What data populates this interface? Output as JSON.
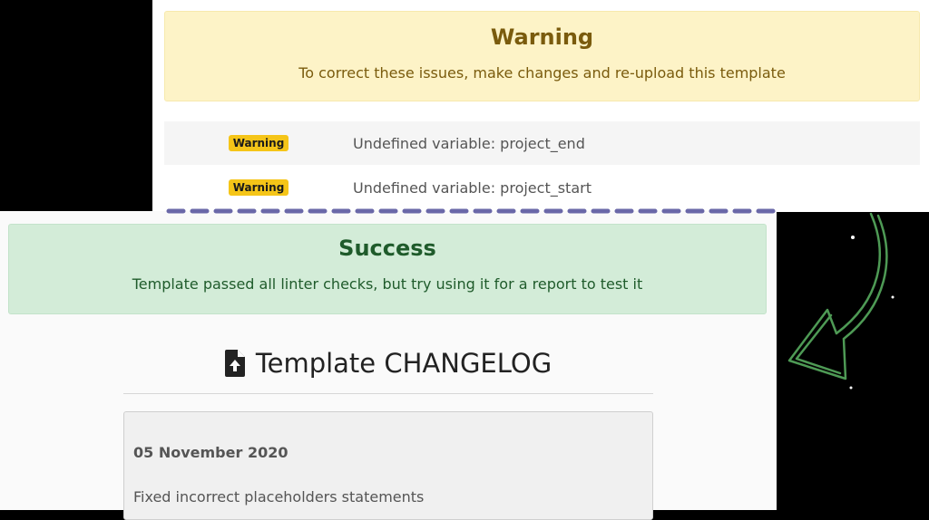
{
  "warning_panel": {
    "title": "Warning",
    "message": "To correct these issues, make changes and re-upload this template",
    "issues": [
      {
        "badge": "Warning",
        "text": "Undefined variable: project_end"
      },
      {
        "badge": "Warning",
        "text": "Undefined variable: project_start"
      }
    ],
    "colors": {
      "background": "#fdf3c7",
      "text": "#7a5b0d",
      "badge": "#f5c518"
    }
  },
  "success_panel": {
    "title": "Success",
    "message": "Template passed all linter checks, but try using it for a report to test it",
    "colors": {
      "background": "#d3ecd8",
      "text": "#1f5b2b"
    }
  },
  "changelog": {
    "icon": "file-upload-icon",
    "heading": "Template CHANGELOG",
    "entries": [
      {
        "date": "05 November 2020",
        "text": "Fixed incorrect placeholders statements"
      }
    ]
  },
  "decorations": {
    "dashed_line_color": "#6a68a8",
    "arrow_color": "#4e9a55"
  }
}
